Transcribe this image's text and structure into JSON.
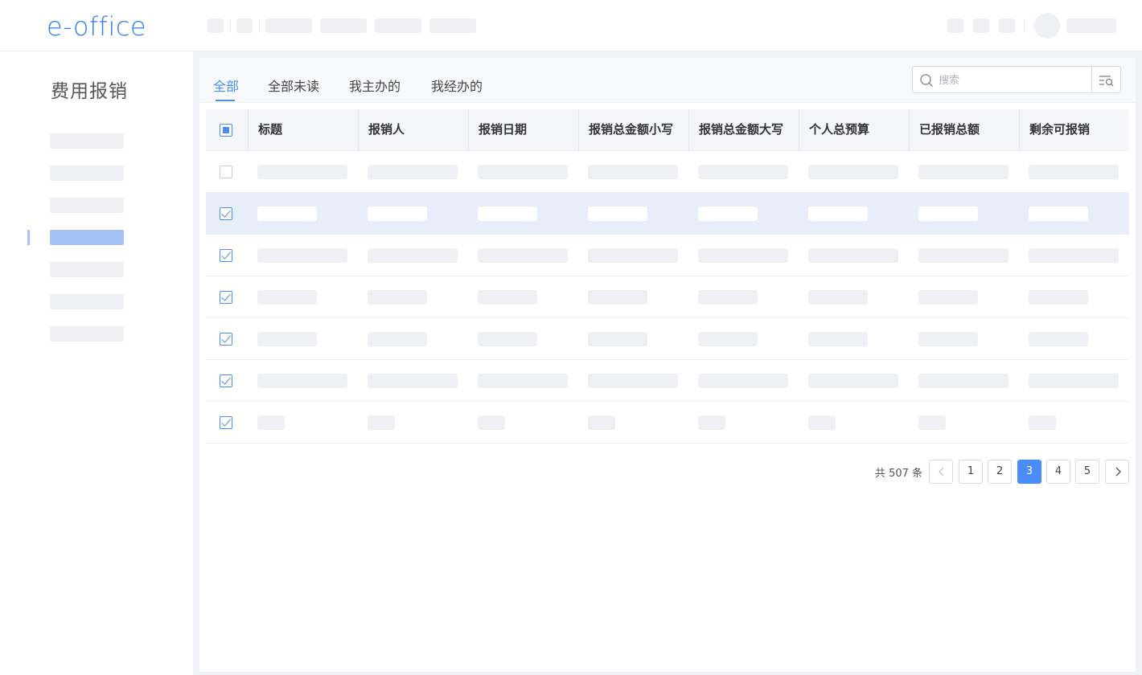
{
  "header": {
    "logo": "e-office"
  },
  "sidebar": {
    "title": "费用报销",
    "active_index": 3,
    "item_count": 7
  },
  "tabs": [
    {
      "label": "全部",
      "active": true
    },
    {
      "label": "全部未读",
      "active": false
    },
    {
      "label": "我主办的",
      "active": false
    },
    {
      "label": "我经办的",
      "active": false
    }
  ],
  "search": {
    "placeholder": "搜索"
  },
  "table": {
    "columns": [
      "标题",
      "报销人",
      "报销日期",
      "报销总金额小写",
      "报销总金额大写",
      "个人总预算",
      "已报销总额",
      "剩余可报销"
    ],
    "header_checkbox": "partial",
    "rows": [
      {
        "checked": false,
        "selected": false
      },
      {
        "checked": true,
        "selected": true
      },
      {
        "checked": true,
        "selected": false
      },
      {
        "checked": true,
        "selected": false
      },
      {
        "checked": true,
        "selected": false
      },
      {
        "checked": true,
        "selected": false
      },
      {
        "checked": true,
        "selected": false
      }
    ]
  },
  "pagination": {
    "total_text": "共 507 条",
    "pages": [
      "1",
      "2",
      "3",
      "4",
      "5"
    ],
    "current": "3"
  },
  "colors": {
    "accent": "#4a8df8",
    "selected_row": "#e8eef9",
    "sidebar_active": "#a5c2f7",
    "logo": "#2f7cf6"
  }
}
